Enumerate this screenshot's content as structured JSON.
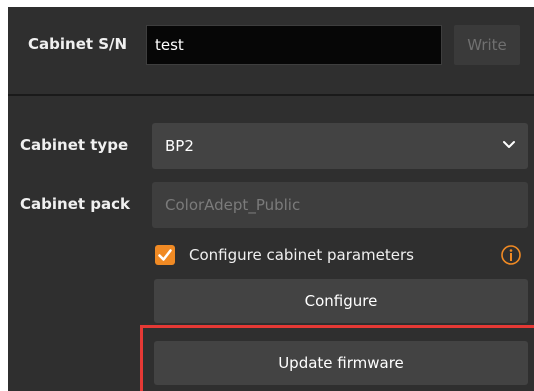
{
  "sn": {
    "label": "Cabinet S/N",
    "value": "test",
    "write_label": "Write"
  },
  "cabinet_type": {
    "label": "Cabinet type",
    "selected": "BP2"
  },
  "cabinet_pack": {
    "label": "Cabinet pack",
    "placeholder": "ColorAdept_Public"
  },
  "configure_params": {
    "checked": true,
    "label": "Configure cabinet parameters"
  },
  "buttons": {
    "configure": "Configure",
    "update_firmware": "Update firmware"
  },
  "colors": {
    "panel_bg": "#2f2f2f",
    "accent": "#f08a24",
    "highlight": "#e53935"
  },
  "icons": {
    "dropdown": "chevron-down-icon",
    "info": "info-icon",
    "check": "checkmark-icon"
  }
}
